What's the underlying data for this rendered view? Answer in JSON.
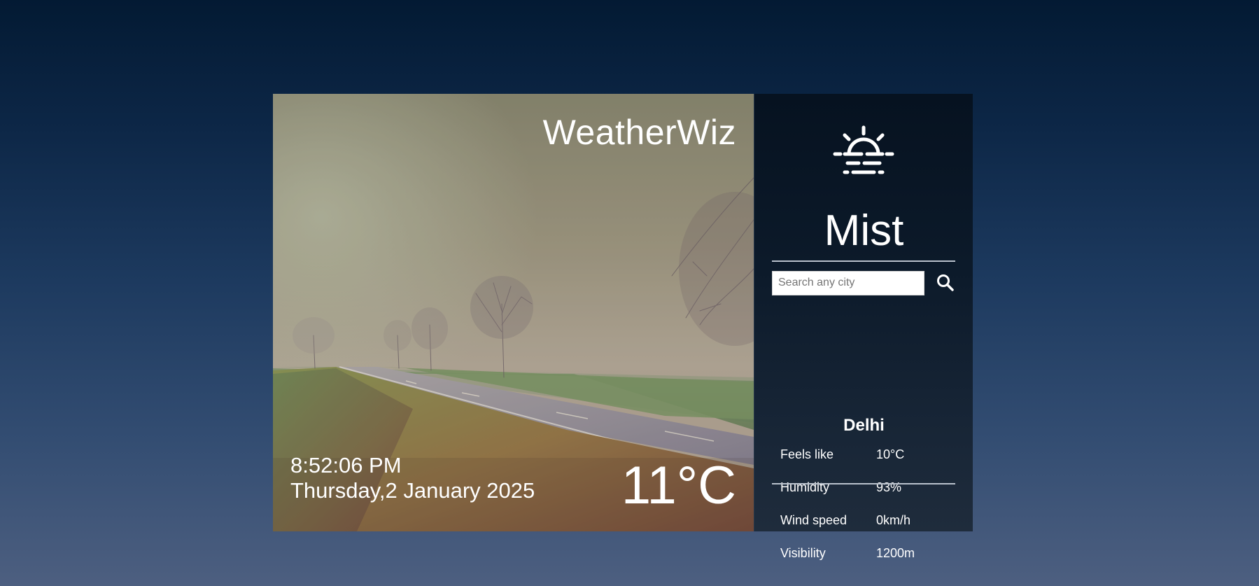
{
  "app": {
    "brand": "WeatherWiz"
  },
  "scene": {
    "time": "8:52:06 PM",
    "date": "Thursday,2 January 2025",
    "temperature": "11°C"
  },
  "panel": {
    "icon": "sunrise-haze-icon",
    "condition": "Mist",
    "search": {
      "placeholder": "Search any city",
      "value": "",
      "icon": "search-icon"
    },
    "city": "Delhi",
    "stats": [
      {
        "label": "Feels like",
        "value": "10°C"
      },
      {
        "label": "Humidity",
        "value": "93%"
      },
      {
        "label": "Wind speed",
        "value": "0km/h"
      },
      {
        "label": "Visibility",
        "value": "1200m"
      }
    ]
  },
  "colors": {
    "page_top": "#031a33",
    "page_bottom": "#4d5f80",
    "panel": "#0c1a2a",
    "text": "#ffffff"
  }
}
